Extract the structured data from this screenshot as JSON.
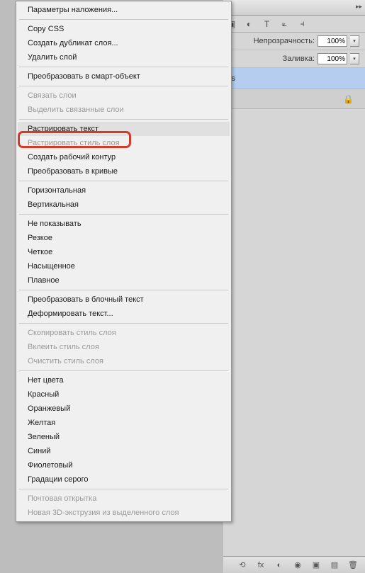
{
  "panels": {
    "tab_arrows": "▸▸",
    "opacity_label": "Непрозрачность:",
    "opacity_value": "100%",
    "fill_label": "Заливка:",
    "fill_value": "100%",
    "layer_partial": "cs",
    "icons": {
      "image": "▣",
      "adjust": "◐",
      "type": "T",
      "warp": "⟀",
      "align": "⫞"
    },
    "bottom_icons": {
      "link": "⟲",
      "fx": "fx",
      "mask": "◐",
      "adjust": "◉",
      "folder": "▣",
      "new": "▤",
      "trash": "🗑"
    }
  },
  "menu": {
    "blending_options": "Параметры наложения...",
    "copy_css": "Copy CSS",
    "duplicate_layer": "Создать дубликат слоя...",
    "delete_layer": "Удалить слой",
    "convert_smart": "Преобразовать в смарт-объект",
    "link_layers": "Связать слои",
    "select_linked": "Выделить связанные слои",
    "rasterize_type": "Растрировать текст",
    "rasterize_style": "Растрировать стиль слоя",
    "create_work_path": "Создать рабочий контур",
    "convert_shape": "Преобразовать в кривые",
    "horizontal": "Горизонтальная",
    "vertical": "Вертикальная",
    "none_aa": "Не показывать",
    "sharp": "Резкое",
    "crisp": "Четкое",
    "strong": "Насыщенное",
    "smooth": "Плавное",
    "convert_paragraph": "Преобразовать в блочный текст",
    "warp_text": "Деформировать текст...",
    "copy_style": "Скопировать стиль слоя",
    "paste_style": "Вклеить стиль слоя",
    "clear_style": "Очистить стиль слоя",
    "no_color": "Нет цвета",
    "red": "Красный",
    "orange": "Оранжевый",
    "yellow": "Желтая",
    "green": "Зеленый",
    "blue": "Синий",
    "violet": "Фиолетовый",
    "gray": "Градации серого",
    "postcard": "Почтовая открытка",
    "extrusion_3d": "Новая 3D-экструзия из выделенного слоя"
  }
}
